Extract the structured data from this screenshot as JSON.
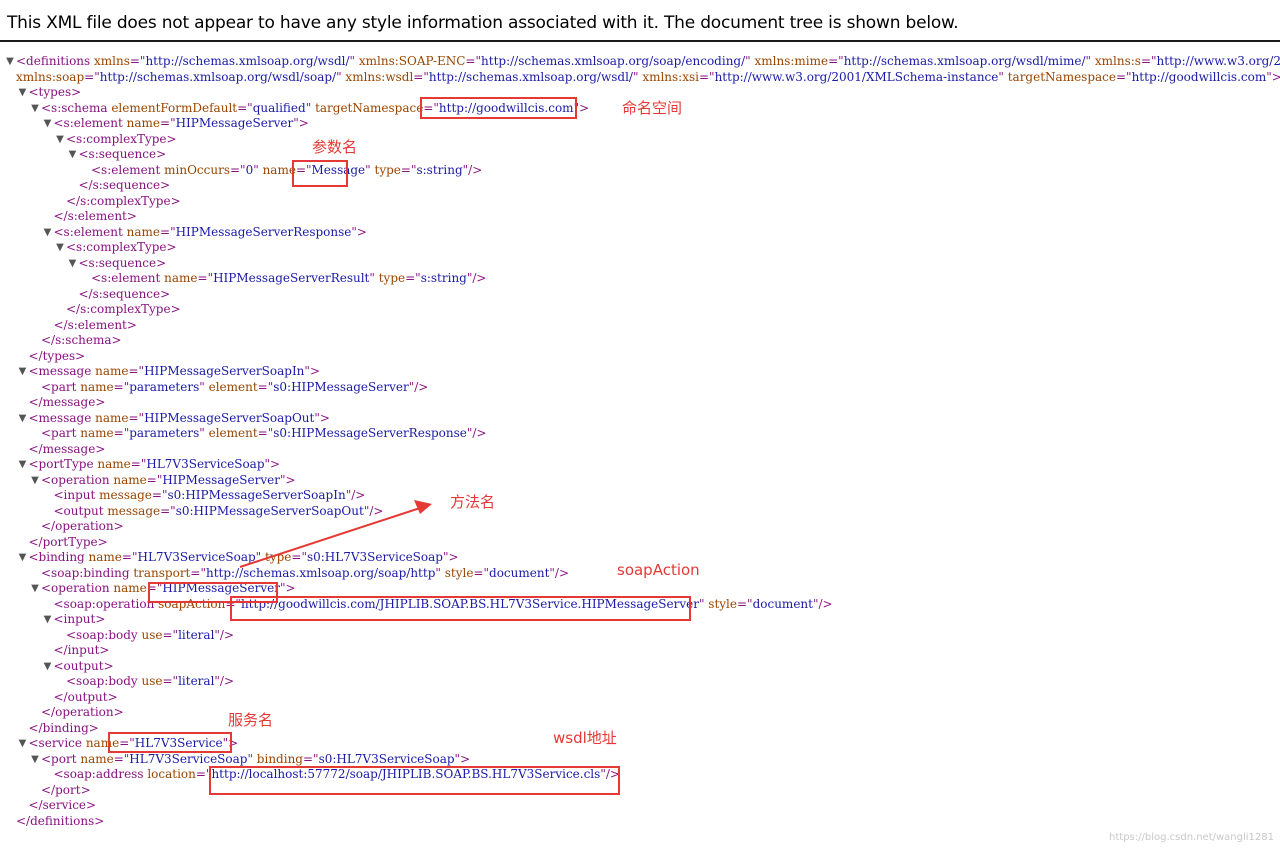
{
  "banner": {
    "text": "This XML file does not appear to have any style information associated with it. The document tree is shown below."
  },
  "tree": {
    "toggle_glyph": "▼",
    "lines": [
      {
        "indent": 0,
        "toggle": true,
        "parts": [
          [
            "tag",
            "<definitions"
          ],
          [
            "an",
            " xmlns"
          ],
          [
            "tag",
            "=\""
          ],
          [
            "av",
            "http://schemas.xmlsoap.org/wsdl/"
          ],
          [
            "tag",
            "\""
          ],
          [
            "an",
            " xmlns:SOAP-ENC"
          ],
          [
            "tag",
            "=\""
          ],
          [
            "av",
            "http://schemas.xmlsoap.org/soap/encoding/"
          ],
          [
            "tag",
            "\""
          ],
          [
            "an",
            " xmlns:mime"
          ],
          [
            "tag",
            "=\""
          ],
          [
            "av",
            "http://schemas.xmlsoap.org/wsdl/mime/"
          ],
          [
            "tag",
            "\""
          ],
          [
            "an",
            " xmlns:s"
          ],
          [
            "tag",
            "=\""
          ],
          [
            "av",
            "http://www.w3.org/2"
          ]
        ]
      },
      {
        "indent": 0,
        "toggle": false,
        "parts": [
          [
            "an",
            "xmlns:soap"
          ],
          [
            "tag",
            "=\""
          ],
          [
            "av",
            "http://schemas.xmlsoap.org/wsdl/soap/"
          ],
          [
            "tag",
            "\""
          ],
          [
            "an",
            " xmlns:wsdl"
          ],
          [
            "tag",
            "=\""
          ],
          [
            "av",
            "http://schemas.xmlsoap.org/wsdl/"
          ],
          [
            "tag",
            "\""
          ],
          [
            "an",
            " xmlns:xsi"
          ],
          [
            "tag",
            "=\""
          ],
          [
            "av",
            "http://www.w3.org/2001/XMLSchema-instance"
          ],
          [
            "tag",
            "\""
          ],
          [
            "an",
            " targetNamespace"
          ],
          [
            "tag",
            "=\""
          ],
          [
            "av",
            "http://goodwillcis.com"
          ],
          [
            "tag",
            "\">"
          ]
        ]
      },
      {
        "indent": 1,
        "toggle": true,
        "parts": [
          [
            "tag",
            "<types>"
          ]
        ]
      },
      {
        "indent": 2,
        "toggle": true,
        "parts": [
          [
            "tag",
            "<s:schema"
          ],
          [
            "an",
            " elementFormDefault"
          ],
          [
            "tag",
            "=\""
          ],
          [
            "av",
            "qualified"
          ],
          [
            "tag",
            "\""
          ],
          [
            "an",
            " targetNamespace"
          ],
          [
            "tag",
            "=\""
          ],
          [
            "av",
            "http://goodwillcis.com"
          ],
          [
            "tag",
            "\">"
          ]
        ]
      },
      {
        "indent": 3,
        "toggle": true,
        "parts": [
          [
            "tag",
            "<s:element"
          ],
          [
            "an",
            " name"
          ],
          [
            "tag",
            "=\""
          ],
          [
            "av",
            "HIPMessageServer"
          ],
          [
            "tag",
            "\">"
          ]
        ]
      },
      {
        "indent": 4,
        "toggle": true,
        "parts": [
          [
            "tag",
            "<s:complexType>"
          ]
        ]
      },
      {
        "indent": 5,
        "toggle": true,
        "parts": [
          [
            "tag",
            "<s:sequence>"
          ]
        ]
      },
      {
        "indent": 6,
        "toggle": false,
        "parts": [
          [
            "tag",
            "<s:element"
          ],
          [
            "an",
            " minOccurs"
          ],
          [
            "tag",
            "=\""
          ],
          [
            "av",
            "0"
          ],
          [
            "tag",
            "\""
          ],
          [
            "an",
            " name"
          ],
          [
            "tag",
            "=\""
          ],
          [
            "av",
            "Message"
          ],
          [
            "tag",
            "\""
          ],
          [
            "an",
            " type"
          ],
          [
            "tag",
            "=\""
          ],
          [
            "av",
            "s:string"
          ],
          [
            "tag",
            "\"/>"
          ]
        ]
      },
      {
        "indent": 5,
        "toggle": false,
        "parts": [
          [
            "tag",
            "</s:sequence>"
          ]
        ]
      },
      {
        "indent": 4,
        "toggle": false,
        "parts": [
          [
            "tag",
            "</s:complexType>"
          ]
        ]
      },
      {
        "indent": 3,
        "toggle": false,
        "parts": [
          [
            "tag",
            "</s:element>"
          ]
        ]
      },
      {
        "indent": 3,
        "toggle": true,
        "parts": [
          [
            "tag",
            "<s:element"
          ],
          [
            "an",
            " name"
          ],
          [
            "tag",
            "=\""
          ],
          [
            "av",
            "HIPMessageServerResponse"
          ],
          [
            "tag",
            "\">"
          ]
        ]
      },
      {
        "indent": 4,
        "toggle": true,
        "parts": [
          [
            "tag",
            "<s:complexType>"
          ]
        ]
      },
      {
        "indent": 5,
        "toggle": true,
        "parts": [
          [
            "tag",
            "<s:sequence>"
          ]
        ]
      },
      {
        "indent": 6,
        "toggle": false,
        "parts": [
          [
            "tag",
            "<s:element"
          ],
          [
            "an",
            " name"
          ],
          [
            "tag",
            "=\""
          ],
          [
            "av",
            "HIPMessageServerResult"
          ],
          [
            "tag",
            "\""
          ],
          [
            "an",
            " type"
          ],
          [
            "tag",
            "=\""
          ],
          [
            "av",
            "s:string"
          ],
          [
            "tag",
            "\"/>"
          ]
        ]
      },
      {
        "indent": 5,
        "toggle": false,
        "parts": [
          [
            "tag",
            "</s:sequence>"
          ]
        ]
      },
      {
        "indent": 4,
        "toggle": false,
        "parts": [
          [
            "tag",
            "</s:complexType>"
          ]
        ]
      },
      {
        "indent": 3,
        "toggle": false,
        "parts": [
          [
            "tag",
            "</s:element>"
          ]
        ]
      },
      {
        "indent": 2,
        "toggle": false,
        "parts": [
          [
            "tag",
            "</s:schema>"
          ]
        ]
      },
      {
        "indent": 1,
        "toggle": false,
        "parts": [
          [
            "tag",
            "</types>"
          ]
        ]
      },
      {
        "indent": 1,
        "toggle": true,
        "parts": [
          [
            "tag",
            "<message"
          ],
          [
            "an",
            " name"
          ],
          [
            "tag",
            "=\""
          ],
          [
            "av",
            "HIPMessageServerSoapIn"
          ],
          [
            "tag",
            "\">"
          ]
        ]
      },
      {
        "indent": 2,
        "toggle": false,
        "parts": [
          [
            "tag",
            "<part"
          ],
          [
            "an",
            " name"
          ],
          [
            "tag",
            "=\""
          ],
          [
            "av",
            "parameters"
          ],
          [
            "tag",
            "\""
          ],
          [
            "an",
            " element"
          ],
          [
            "tag",
            "=\""
          ],
          [
            "av",
            "s0:HIPMessageServer"
          ],
          [
            "tag",
            "\"/>"
          ]
        ]
      },
      {
        "indent": 1,
        "toggle": false,
        "parts": [
          [
            "tag",
            "</message>"
          ]
        ]
      },
      {
        "indent": 1,
        "toggle": true,
        "parts": [
          [
            "tag",
            "<message"
          ],
          [
            "an",
            " name"
          ],
          [
            "tag",
            "=\""
          ],
          [
            "av",
            "HIPMessageServerSoapOut"
          ],
          [
            "tag",
            "\">"
          ]
        ]
      },
      {
        "indent": 2,
        "toggle": false,
        "parts": [
          [
            "tag",
            "<part"
          ],
          [
            "an",
            " name"
          ],
          [
            "tag",
            "=\""
          ],
          [
            "av",
            "parameters"
          ],
          [
            "tag",
            "\""
          ],
          [
            "an",
            " element"
          ],
          [
            "tag",
            "=\""
          ],
          [
            "av",
            "s0:HIPMessageServerResponse"
          ],
          [
            "tag",
            "\"/>"
          ]
        ]
      },
      {
        "indent": 1,
        "toggle": false,
        "parts": [
          [
            "tag",
            "</message>"
          ]
        ]
      },
      {
        "indent": 1,
        "toggle": true,
        "parts": [
          [
            "tag",
            "<portType"
          ],
          [
            "an",
            " name"
          ],
          [
            "tag",
            "=\""
          ],
          [
            "av",
            "HL7V3ServiceSoap"
          ],
          [
            "tag",
            "\">"
          ]
        ]
      },
      {
        "indent": 2,
        "toggle": true,
        "parts": [
          [
            "tag",
            "<operation"
          ],
          [
            "an",
            " name"
          ],
          [
            "tag",
            "=\""
          ],
          [
            "av",
            "HIPMessageServer"
          ],
          [
            "tag",
            "\">"
          ]
        ]
      },
      {
        "indent": 3,
        "toggle": false,
        "parts": [
          [
            "tag",
            "<input"
          ],
          [
            "an",
            " message"
          ],
          [
            "tag",
            "=\""
          ],
          [
            "av",
            "s0:HIPMessageServerSoapIn"
          ],
          [
            "tag",
            "\"/>"
          ]
        ]
      },
      {
        "indent": 3,
        "toggle": false,
        "parts": [
          [
            "tag",
            "<output"
          ],
          [
            "an",
            " message"
          ],
          [
            "tag",
            "=\""
          ],
          [
            "av",
            "s0:HIPMessageServerSoapOut"
          ],
          [
            "tag",
            "\"/>"
          ]
        ]
      },
      {
        "indent": 2,
        "toggle": false,
        "parts": [
          [
            "tag",
            "</operation>"
          ]
        ]
      },
      {
        "indent": 1,
        "toggle": false,
        "parts": [
          [
            "tag",
            "</portType>"
          ]
        ]
      },
      {
        "indent": 1,
        "toggle": true,
        "parts": [
          [
            "tag",
            "<binding"
          ],
          [
            "an",
            " name"
          ],
          [
            "tag",
            "=\""
          ],
          [
            "av",
            "HL7V3ServiceSoap"
          ],
          [
            "tag",
            "\""
          ],
          [
            "an",
            " type"
          ],
          [
            "tag",
            "=\""
          ],
          [
            "av",
            "s0:HL7V3ServiceSoap"
          ],
          [
            "tag",
            "\">"
          ]
        ]
      },
      {
        "indent": 2,
        "toggle": false,
        "parts": [
          [
            "tag",
            "<soap:binding"
          ],
          [
            "an",
            " transport"
          ],
          [
            "tag",
            "=\""
          ],
          [
            "av",
            "http://schemas.xmlsoap.org/soap/http"
          ],
          [
            "tag",
            "\""
          ],
          [
            "an",
            " style"
          ],
          [
            "tag",
            "=\""
          ],
          [
            "av",
            "document"
          ],
          [
            "tag",
            "\"/>"
          ]
        ]
      },
      {
        "indent": 2,
        "toggle": true,
        "parts": [
          [
            "tag",
            "<operation"
          ],
          [
            "an",
            " name"
          ],
          [
            "tag",
            "=\""
          ],
          [
            "av",
            "HIPMessageServer"
          ],
          [
            "tag",
            "\">"
          ]
        ]
      },
      {
        "indent": 3,
        "toggle": false,
        "parts": [
          [
            "tag",
            "<soap:operation"
          ],
          [
            "an",
            " soapAction"
          ],
          [
            "tag",
            "=\""
          ],
          [
            "av",
            "http://goodwillcis.com/JHIPLIB.SOAP.BS.HL7V3Service.HIPMessageServer"
          ],
          [
            "tag",
            "\""
          ],
          [
            "an",
            " style"
          ],
          [
            "tag",
            "=\""
          ],
          [
            "av",
            "document"
          ],
          [
            "tag",
            "\"/>"
          ]
        ]
      },
      {
        "indent": 3,
        "toggle": true,
        "parts": [
          [
            "tag",
            "<input>"
          ]
        ]
      },
      {
        "indent": 4,
        "toggle": false,
        "parts": [
          [
            "tag",
            "<soap:body"
          ],
          [
            "an",
            " use"
          ],
          [
            "tag",
            "=\""
          ],
          [
            "av",
            "literal"
          ],
          [
            "tag",
            "\"/>"
          ]
        ]
      },
      {
        "indent": 3,
        "toggle": false,
        "parts": [
          [
            "tag",
            "</input>"
          ]
        ]
      },
      {
        "indent": 3,
        "toggle": true,
        "parts": [
          [
            "tag",
            "<output>"
          ]
        ]
      },
      {
        "indent": 4,
        "toggle": false,
        "parts": [
          [
            "tag",
            "<soap:body"
          ],
          [
            "an",
            " use"
          ],
          [
            "tag",
            "=\""
          ],
          [
            "av",
            "literal"
          ],
          [
            "tag",
            "\"/>"
          ]
        ]
      },
      {
        "indent": 3,
        "toggle": false,
        "parts": [
          [
            "tag",
            "</output>"
          ]
        ]
      },
      {
        "indent": 2,
        "toggle": false,
        "parts": [
          [
            "tag",
            "</operation>"
          ]
        ]
      },
      {
        "indent": 1,
        "toggle": false,
        "parts": [
          [
            "tag",
            "</binding>"
          ]
        ]
      },
      {
        "indent": 1,
        "toggle": true,
        "parts": [
          [
            "tag",
            "<service"
          ],
          [
            "an",
            " name"
          ],
          [
            "tag",
            "=\""
          ],
          [
            "av",
            "HL7V3Service"
          ],
          [
            "tag",
            "\">"
          ]
        ]
      },
      {
        "indent": 2,
        "toggle": true,
        "parts": [
          [
            "tag",
            "<port"
          ],
          [
            "an",
            " name"
          ],
          [
            "tag",
            "=\""
          ],
          [
            "av",
            "HL7V3ServiceSoap"
          ],
          [
            "tag",
            "\""
          ],
          [
            "an",
            " binding"
          ],
          [
            "tag",
            "=\""
          ],
          [
            "av",
            "s0:HL7V3ServiceSoap"
          ],
          [
            "tag",
            "\">"
          ]
        ]
      },
      {
        "indent": 3,
        "toggle": false,
        "parts": [
          [
            "tag",
            "<soap:address"
          ],
          [
            "an",
            " location"
          ],
          [
            "tag",
            "=\""
          ],
          [
            "av",
            "http://localhost:57772/soap/JHIPLIB.SOAP.BS.HL7V3Service.cls"
          ],
          [
            "tag",
            "\"/>"
          ]
        ]
      },
      {
        "indent": 2,
        "toggle": false,
        "parts": [
          [
            "tag",
            "</port>"
          ]
        ]
      },
      {
        "indent": 1,
        "toggle": false,
        "parts": [
          [
            "tag",
            "</service>"
          ]
        ]
      },
      {
        "indent": 0,
        "toggle": false,
        "parts": [
          [
            "tag",
            "</definitions>"
          ]
        ]
      }
    ]
  },
  "annotations": [
    {
      "key": "namespace",
      "text": "命名空间"
    },
    {
      "key": "param",
      "text": "参数名"
    },
    {
      "key": "method",
      "text": "方法名"
    },
    {
      "key": "soapaction",
      "text": "soapAction"
    },
    {
      "key": "service",
      "text": "服务名"
    },
    {
      "key": "wsdl",
      "text": "wsdl地址"
    }
  ],
  "colors": {
    "tag": "#881280",
    "attr_name": "#994500",
    "attr_value": "#1a1aa6",
    "annotation": "#e53935"
  },
  "watermark": "https://blog.csdn.net/wangli1281"
}
